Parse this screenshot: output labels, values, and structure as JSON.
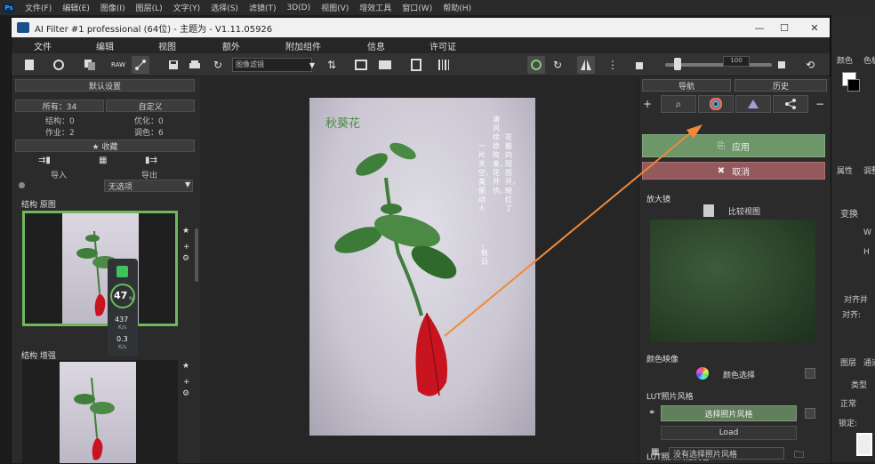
{
  "ps": {
    "logo": "Ps",
    "menu": [
      "文件(F)",
      "编辑(E)",
      "图像(I)",
      "图层(L)",
      "文字(Y)",
      "选择(S)",
      "滤镜(T)",
      "3D(D)",
      "视图(V)",
      "增效工具",
      "窗口(W)",
      "帮助(H)"
    ],
    "right_labels": {
      "tab1": "颜色",
      "tab2": "色板",
      "tab3": "属性",
      "tab4": "调整",
      "section": "变换",
      "w": "W",
      "h": "H",
      "align": "对齐并",
      "align_sub": "对齐:",
      "layers": "图层",
      "channels": "通道",
      "search": "类型",
      "normal": "正常",
      "lock": "锁定:"
    }
  },
  "window": {
    "title": "AI Filter #1 professional (64位) - 主题为 - V1.11.05926",
    "controls": {
      "minimize": "—",
      "maximize": "☐",
      "close": "✕"
    }
  },
  "menu": [
    "文件",
    "编辑",
    "视图",
    "额外",
    "附加组件",
    "信息",
    "许可证"
  ],
  "toolbar": {
    "preset": "图像滤镜",
    "zoom_value": "100"
  },
  "left": {
    "header": "默认设置",
    "tab_all": "所有：34",
    "tab_custom": "自定义",
    "stats": {
      "r1c1": "结构：0",
      "r1c2": "优化：0",
      "r2c1": "作业：2",
      "r2c2": "调色：6"
    },
    "favorites": "★ 收藏",
    "import": "导入",
    "export": "导出",
    "dropdown": "无选项",
    "thumb1_label": "结构 原图",
    "thumb2_label": "结构 增强",
    "overlay": {
      "score": "47",
      "percent": "%",
      "up": "437",
      "up_unit": "K/s",
      "down": "0.3",
      "down_unit": "K/s"
    }
  },
  "photo": {
    "title": "秋葵花",
    "poem_col1": "清风徐徐吹来，花开也，",
    "poem_col2": "花瓣向阳而开，映红了",
    "poem_col3": "一片天空，美丽动人",
    "poem_col4": "，秋日"
  },
  "right": {
    "tab1": "导航",
    "tab2": "历史",
    "apply": "应用",
    "cancel": "取消",
    "magnifier_title": "放大镜",
    "compare": "比较视图",
    "color_section": "颜色映像",
    "color_btn": "颜色选择",
    "lut_section": "LUT照片风格",
    "lut_btn1": "选择照片风格",
    "lut_btn2": "Load",
    "lut_section2": "LUT照片风格调色",
    "lut_dropdown": "没有选择照片风格"
  },
  "colors": {
    "accent_green": "#6d9669",
    "cancel_red": "#93595c",
    "photo_bg": "#cac6d2",
    "leaf": "#3f7f3b",
    "flower": "#c8141e"
  }
}
